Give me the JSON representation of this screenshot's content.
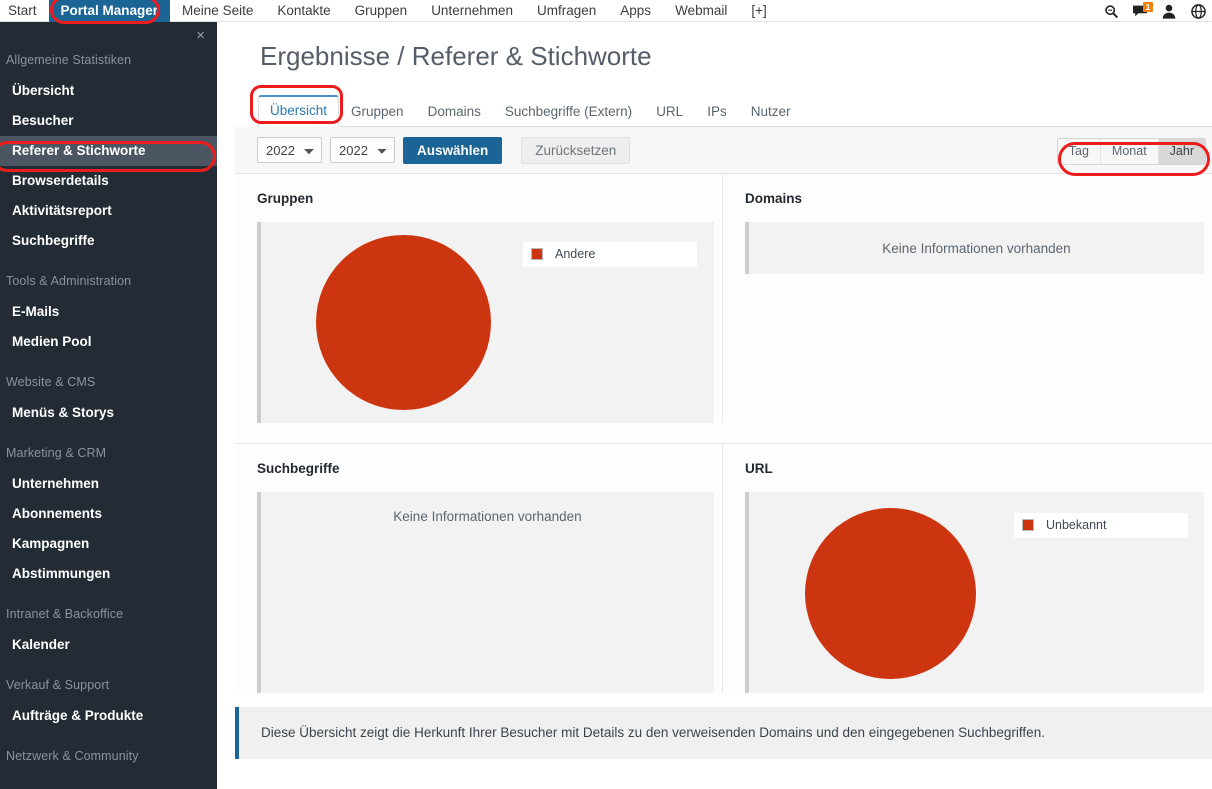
{
  "topnav": {
    "items": [
      {
        "label": "Start",
        "active": false
      },
      {
        "label": "Portal Manager",
        "active": true
      },
      {
        "label": "Meine Seite",
        "active": false
      },
      {
        "label": "Kontakte",
        "active": false
      },
      {
        "label": "Gruppen",
        "active": false
      },
      {
        "label": "Unternehmen",
        "active": false
      },
      {
        "label": "Umfragen",
        "active": false
      },
      {
        "label": "Apps",
        "active": false
      },
      {
        "label": "Webmail",
        "active": false
      },
      {
        "label": "[+]",
        "active": false
      }
    ],
    "icons": [
      {
        "name": "search-icon",
        "glyph": "⌕"
      },
      {
        "name": "messages-icon",
        "glyph": "▬",
        "badge": "1"
      },
      {
        "name": "user-icon",
        "glyph": "♟"
      },
      {
        "name": "globe-icon",
        "glyph": "◔"
      }
    ],
    "badge_count": "1",
    "badge_color": "#f0820a",
    "active_color": "#1a6496"
  },
  "sidebar": {
    "close_label": "×",
    "sections": [
      {
        "group": "Allgemeine Statistiken",
        "items": [
          {
            "label": "Übersicht",
            "active": false
          },
          {
            "label": "Besucher",
            "active": false
          },
          {
            "label": "Referer & Stichworte",
            "active": true
          },
          {
            "label": "Browserdetails",
            "active": false
          },
          {
            "label": "Aktivitätsreport",
            "active": false
          },
          {
            "label": "Suchbegriffe",
            "active": false
          }
        ]
      },
      {
        "group": "Tools & Administration",
        "items": [
          {
            "label": "E-Mails",
            "active": false
          },
          {
            "label": "Medien Pool",
            "active": false
          }
        ]
      },
      {
        "group": "Website & CMS",
        "items": [
          {
            "label": "Menüs & Storys",
            "active": false
          }
        ]
      },
      {
        "group": "Marketing & CRM",
        "items": [
          {
            "label": "Unternehmen",
            "active": false
          },
          {
            "label": "Abonnements",
            "active": false
          },
          {
            "label": "Kampagnen",
            "active": false
          },
          {
            "label": "Abstimmungen",
            "active": false
          }
        ]
      },
      {
        "group": "Intranet & Backoffice",
        "items": [
          {
            "label": "Kalender",
            "active": false
          }
        ]
      },
      {
        "group": "Verkauf & Support",
        "items": [
          {
            "label": "Aufträge & Produkte",
            "active": false
          }
        ]
      },
      {
        "group": "Netzwerk & Community",
        "items": []
      }
    ]
  },
  "page": {
    "title": "Ergebnisse / Referer & Stichworte"
  },
  "tabs": [
    {
      "label": "Übersicht",
      "active": true
    },
    {
      "label": "Gruppen",
      "active": false
    },
    {
      "label": "Domains",
      "active": false
    },
    {
      "label": "Suchbegriffe (Extern)",
      "active": false
    },
    {
      "label": "URL",
      "active": false
    },
    {
      "label": "IPs",
      "active": false
    },
    {
      "label": "Nutzer",
      "active": false
    }
  ],
  "toolbar": {
    "year_from": "2022",
    "year_to": "2022",
    "year_options": [
      "2022"
    ],
    "select_label": "Auswählen",
    "reset_label": "Zurücksetzen",
    "segments": [
      {
        "label": "Tag",
        "active": false
      },
      {
        "label": "Monat",
        "active": false
      },
      {
        "label": "Jahr",
        "active": true
      }
    ]
  },
  "empty_message": "Keine Informationen vorhanden",
  "panels": [
    {
      "title": "Gruppen",
      "has_chart": true,
      "legend": [
        {
          "label": "Andere",
          "color": "#cc3510"
        }
      ]
    },
    {
      "title": "Domains",
      "has_chart": false,
      "legend": []
    },
    {
      "title": "Suchbegriffe",
      "has_chart": false,
      "legend": []
    },
    {
      "title": "URL",
      "has_chart": true,
      "legend": [
        {
          "label": "Unbekannt",
          "color": "#cc3510"
        }
      ]
    }
  ],
  "footer": {
    "info": "Diese Übersicht zeigt die Herkunft Ihrer Besucher mit Details zu den verweisenden Domains und den eingegebenen Suchbegriffen."
  },
  "chart_data": [
    {
      "type": "pie",
      "title": "Gruppen",
      "labels": [
        "Andere"
      ],
      "values": [
        100
      ],
      "colors": [
        "#cc3510"
      ],
      "legend_position": "right",
      "unit": "%"
    },
    {
      "type": "pie",
      "title": "Domains",
      "labels": [],
      "values": [],
      "colors": [],
      "legend_position": "none",
      "note": "Keine Informationen vorhanden"
    },
    {
      "type": "pie",
      "title": "Suchbegriffe",
      "labels": [],
      "values": [],
      "colors": [],
      "legend_position": "none",
      "note": "Keine Informationen vorhanden"
    },
    {
      "type": "pie",
      "title": "URL",
      "labels": [
        "Unbekannt"
      ],
      "values": [
        100
      ],
      "colors": [
        "#cc3510"
      ],
      "legend_position": "right",
      "unit": "%"
    }
  ]
}
